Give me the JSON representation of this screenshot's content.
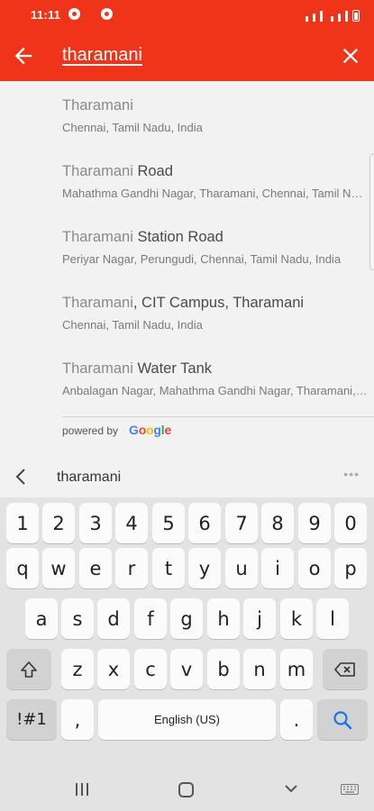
{
  "status_bar": {
    "time": "11:11"
  },
  "search": {
    "query": "tharamani"
  },
  "results": [
    {
      "title_main": "Tharamani",
      "title_rest": "",
      "subtitle": "Chennai, Tamil Nadu, India"
    },
    {
      "title_main": "Tharamani",
      "title_rest": " Road",
      "subtitle": "Mahathma Gandhi Nagar, Tharamani, Chennai, Tamil Nadu, India"
    },
    {
      "title_main": "Tharamani",
      "title_rest": " Station Road",
      "subtitle": "Periyar Nagar, Perungudi, Chennai, Tamil Nadu, India"
    },
    {
      "title_main": "Tharamani",
      "title_rest": ", CIT Campus, Tharamani",
      "subtitle": "Chennai, Tamil Nadu, India"
    },
    {
      "title_main": "Tharamani",
      "title_rest": " Water Tank",
      "subtitle": "Anbalagan Nagar, Mahathma Gandhi Nagar, Tharamani, Chennai"
    }
  ],
  "attribution": {
    "powered_by": "powered by",
    "google": "Google"
  },
  "suggestion_strip": {
    "text": "tharamani",
    "more": "•••"
  },
  "keyboard": {
    "row1": [
      "1",
      "2",
      "3",
      "4",
      "5",
      "6",
      "7",
      "8",
      "9",
      "0"
    ],
    "row2": [
      "q",
      "w",
      "e",
      "r",
      "t",
      "y",
      "u",
      "i",
      "o",
      "p"
    ],
    "row3": [
      "a",
      "s",
      "d",
      "f",
      "g",
      "h",
      "j",
      "k",
      "l"
    ],
    "row4": [
      "z",
      "x",
      "c",
      "v",
      "b",
      "n",
      "m"
    ],
    "symbols_label": "!#1",
    "comma": ",",
    "space_label": "English (US)",
    "period": "."
  },
  "colors": {
    "accent": "#f0341a",
    "search_key": "#1a73e8"
  }
}
